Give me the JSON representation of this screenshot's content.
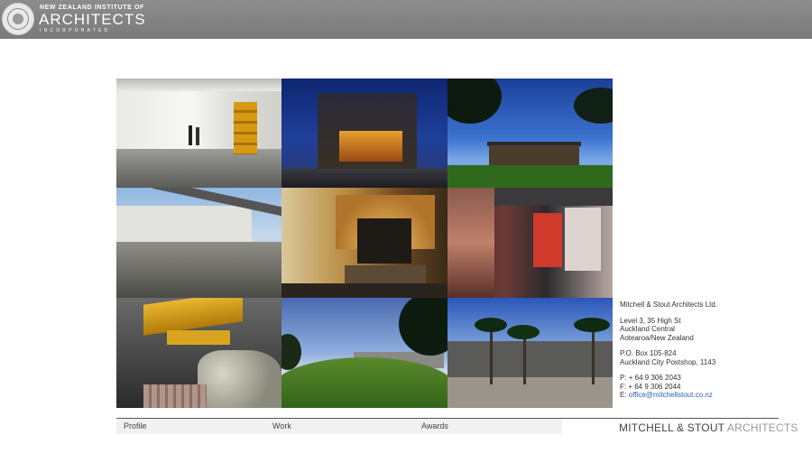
{
  "header": {
    "org_line1": "NEW ZEALAND INSTITUTE OF",
    "org_line2": "ARCHITECTS",
    "org_line3": "INCORPORATED",
    "seal_icon": "nzia-seal-icon"
  },
  "gallery": {
    "photos": [
      {
        "alt": "gallery-interior"
      },
      {
        "alt": "building-at-night"
      },
      {
        "alt": "house-on-hill"
      },
      {
        "alt": "white-building-shade"
      },
      {
        "alt": "fireplace-lounge"
      },
      {
        "alt": "red-interior"
      },
      {
        "alt": "yellow-canopy-rocks"
      },
      {
        "alt": "grass-roof-building"
      },
      {
        "alt": "palm-tree-building"
      }
    ]
  },
  "contact": {
    "company": "Mitchell & Stout Architects Ltd.",
    "address1": "Level 3, 35 High St",
    "address2": "Auckland Central",
    "address3": "Aotearoa/New Zealand",
    "po1": "P.O. Box 105-824",
    "po2": "Auckland City Postshop, 1143",
    "phone": "P: + 64 9 306 2043",
    "fax": "F: + 64 9 306 2044",
    "email_prefix": "E:",
    "email": "office@mitchellstout.co.nz"
  },
  "nav": {
    "items": [
      "Profile",
      "Work",
      "Awards"
    ]
  },
  "logo": {
    "part1": "MITCHELL & STOUT",
    "part2": "ARCHITECTS"
  },
  "colors": {
    "banner": "#808080",
    "link": "#2a5fb0"
  }
}
